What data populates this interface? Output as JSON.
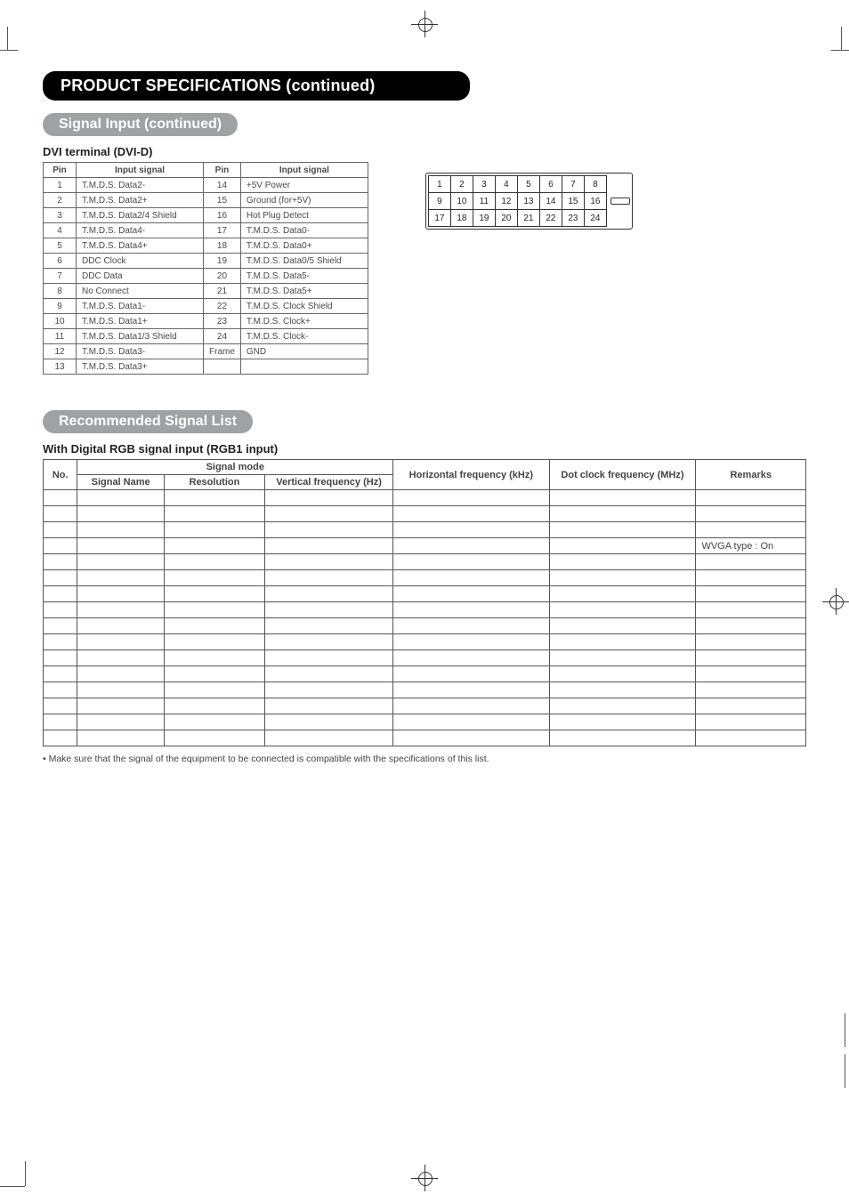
{
  "headings": {
    "main": "PRODUCT SPECIFICATIONS (continued)",
    "signal_input": "Signal Input (continued)",
    "dvi_terminal": "DVI terminal (DVI-D)",
    "recommended": "Recommended Signal List",
    "with_digital": "With Digital RGB signal input (RGB1 input)"
  },
  "dvi_table": {
    "headers": {
      "pin": "Pin",
      "signal": "Input signal"
    },
    "rows": [
      {
        "p1": "1",
        "s1": "T.M.D.S. Data2-",
        "p2": "14",
        "s2": "+5V Power"
      },
      {
        "p1": "2",
        "s1": "T.M.D.S. Data2+",
        "p2": "15",
        "s2": "Ground (for+5V)"
      },
      {
        "p1": "3",
        "s1": "T.M.D.S. Data2/4 Shield",
        "p2": "16",
        "s2": "Hot Plug Detect"
      },
      {
        "p1": "4",
        "s1": "T.M.D.S. Data4-",
        "p2": "17",
        "s2": "T.M.D.S. Data0-"
      },
      {
        "p1": "5",
        "s1": "T.M.D.S. Data4+",
        "p2": "18",
        "s2": "T.M.D.S. Data0+"
      },
      {
        "p1": "6",
        "s1": "DDC Clock",
        "p2": "19",
        "s2": "T.M.D.S. Data0/5 Shield"
      },
      {
        "p1": "7",
        "s1": "DDC Data",
        "p2": "20",
        "s2": "T.M.D.S. Data5-"
      },
      {
        "p1": "8",
        "s1": "No Connect",
        "p2": "21",
        "s2": "T.M.D.S. Data5+"
      },
      {
        "p1": "9",
        "s1": "T.M.D.S. Data1-",
        "p2": "22",
        "s2": "T.M.D.S. Clock Shield"
      },
      {
        "p1": "10",
        "s1": "T.M.D.S. Data1+",
        "p2": "23",
        "s2": "T.M.D.S. Clock+"
      },
      {
        "p1": "11",
        "s1": "T.M.D.S. Data1/3 Shield",
        "p2": "24",
        "s2": "T.M.D.S. Clock-"
      },
      {
        "p1": "12",
        "s1": "T.M.D.S. Data3-",
        "p2": "Frame",
        "s2": "GND"
      },
      {
        "p1": "13",
        "s1": "T.M.D.S. Data3+",
        "p2": "",
        "s2": ""
      }
    ]
  },
  "connector_pins": [
    [
      "1",
      "2",
      "3",
      "4",
      "5",
      "6",
      "7",
      "8"
    ],
    [
      "9",
      "10",
      "11",
      "12",
      "13",
      "14",
      "15",
      "16"
    ],
    [
      "17",
      "18",
      "19",
      "20",
      "21",
      "22",
      "23",
      "24"
    ]
  ],
  "spec_table": {
    "headers": {
      "no": "No.",
      "mode": "Signal mode",
      "name": "Signal Name",
      "res": "Resolution",
      "vfreq": "Vertical frequency (Hz)",
      "hfreq": "Horizontal frequency (kHz)",
      "dclk": "Dot clock frequency (MHz)",
      "remarks": "Remarks"
    },
    "remarks_wvga": "WVGA type : On",
    "row_count": 16
  },
  "footnote": "• Make sure that the signal of the equipment to be connected is compatible with the specifications of this list."
}
